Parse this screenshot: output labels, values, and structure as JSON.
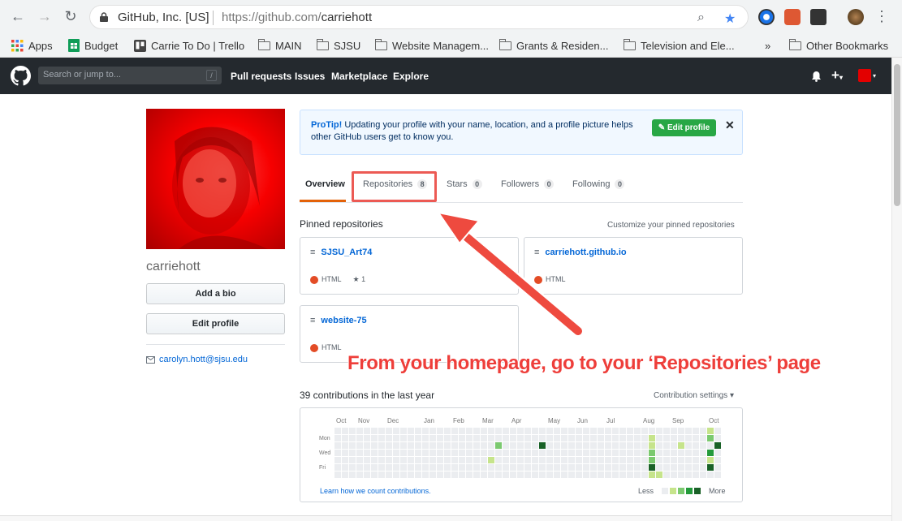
{
  "browser": {
    "site_identity": "GitHub, Inc. [US]",
    "url_host": "https://github.com/",
    "url_path": "carriehott",
    "bookmarks": [
      {
        "label": "Apps",
        "icon": "apps-icon"
      },
      {
        "label": "Budget",
        "icon": "sheets-icon"
      },
      {
        "label": "Carrie To Do | Trello",
        "icon": "trello-icon"
      },
      {
        "label": "MAIN",
        "icon": "folder-icon"
      },
      {
        "label": "SJSU",
        "icon": "folder-icon"
      },
      {
        "label": "Website Managem...",
        "icon": "folder-icon"
      },
      {
        "label": "Grants & Residen...",
        "icon": "folder-icon"
      },
      {
        "label": "Television and Ele...",
        "icon": "folder-icon"
      },
      {
        "label": "Other Bookmarks",
        "icon": "folder-icon"
      }
    ],
    "more_bookmarks": "»"
  },
  "header": {
    "search_placeholder": "Search or jump to...",
    "slash_key": "/",
    "nav": [
      "Pull requests",
      "Issues",
      "Marketplace",
      "Explore"
    ]
  },
  "profile": {
    "username": "carriehott",
    "add_bio": "Add a bio",
    "edit_profile": "Edit profile",
    "email": "carolyn.hott@sjsu.edu"
  },
  "protip": {
    "lead": "ProTip!",
    "text": " Updating your profile with your name, location, and a profile picture helps other GitHub users get to know you.",
    "button": "Edit profile",
    "close": "✕"
  },
  "tabs": [
    {
      "label": "Overview",
      "count": ""
    },
    {
      "label": "Repositories",
      "count": "8"
    },
    {
      "label": "Stars",
      "count": "0"
    },
    {
      "label": "Followers",
      "count": "0"
    },
    {
      "label": "Following",
      "count": "0"
    }
  ],
  "pinned": {
    "title": "Pinned repositories",
    "customize": "Customize your pinned repositories",
    "repos": [
      {
        "name": "SJSU_Art74",
        "language": "HTML",
        "stars": "1"
      },
      {
        "name": "carriehott.github.io",
        "language": "HTML",
        "stars": ""
      },
      {
        "name": "website-75",
        "language": "HTML",
        "stars": ""
      }
    ]
  },
  "annotation": "From your homepage, go to your ‘Repositories’ page",
  "contributions": {
    "title": "39 contributions in the last year",
    "settings": "Contribution settings ▾",
    "months": [
      "Oct",
      "Nov",
      "Dec",
      "Jan",
      "Feb",
      "Mar",
      "Apr",
      "May",
      "Jun",
      "Jul",
      "Aug",
      "Sep",
      "Oct"
    ],
    "days": [
      "Mon",
      "Wed",
      "Fri"
    ],
    "learn": "Learn how we count contributions.",
    "less": "Less",
    "more": "More",
    "colors": [
      "#ebedf0",
      "#c6e48b",
      "#7bc96f",
      "#239a3b",
      "#196127"
    ]
  }
}
